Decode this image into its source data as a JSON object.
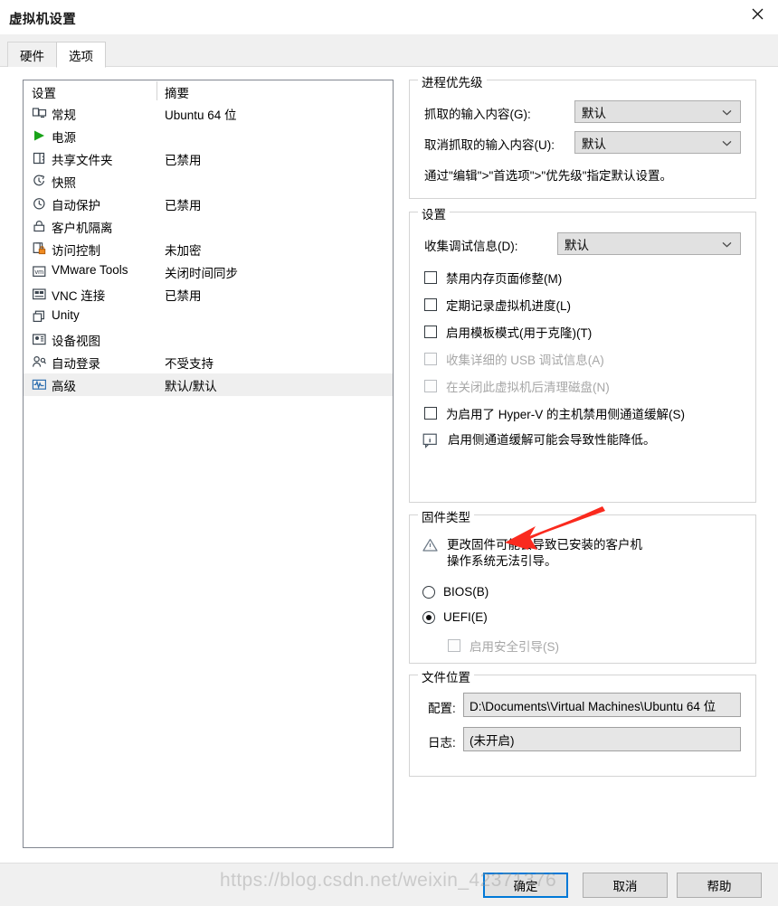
{
  "window": {
    "title": "虚拟机设置",
    "close_icon": "close-icon"
  },
  "tabs": [
    {
      "label": "硬件",
      "active": false
    },
    {
      "label": "选项",
      "active": true
    }
  ],
  "settings_list": {
    "headers": {
      "name": "设置",
      "summary": "摘要"
    },
    "rows": [
      {
        "icon": "monitor-icon",
        "name": "常规",
        "summary": "Ubuntu 64 位",
        "selected": false
      },
      {
        "icon": "power-play-icon",
        "name": "电源",
        "summary": "",
        "selected": false
      },
      {
        "icon": "shared-folder-icon",
        "name": "共享文件夹",
        "summary": "已禁用",
        "selected": false
      },
      {
        "icon": "snapshot-icon",
        "name": "快照",
        "summary": "",
        "selected": false
      },
      {
        "icon": "autoprotect-icon",
        "name": "自动保护",
        "summary": "已禁用",
        "selected": false
      },
      {
        "icon": "lock-icon",
        "name": "客户机隔离",
        "summary": "",
        "selected": false
      },
      {
        "icon": "access-lock-icon",
        "name": "访问控制",
        "summary": "未加密",
        "selected": false
      },
      {
        "icon": "vmware-tools-icon",
        "name": "VMware Tools",
        "summary": "关闭时间同步",
        "selected": false
      },
      {
        "icon": "vnc-icon",
        "name": "VNC 连接",
        "summary": "已禁用",
        "selected": false
      },
      {
        "icon": "unity-icon",
        "name": "Unity",
        "summary": "",
        "selected": false
      },
      {
        "icon": "device-view-icon",
        "name": "设备视图",
        "summary": "",
        "selected": false
      },
      {
        "icon": "autologon-icon",
        "name": "自动登录",
        "summary": "不受支持",
        "selected": false
      },
      {
        "icon": "advanced-icon",
        "name": "高级",
        "summary": "默认/默认",
        "selected": true
      }
    ]
  },
  "process_priority": {
    "legend": "进程优先级",
    "grab_label": "抓取的输入内容(G):",
    "grab_value": "默认",
    "ungrab_label": "取消抓取的输入内容(U):",
    "ungrab_value": "默认",
    "hint": "通过\"编辑\">\"首选项\">\"优先级\"指定默认设置。"
  },
  "settings_group": {
    "legend": "设置",
    "debug_label": "收集调试信息(D):",
    "debug_value": "默认",
    "checkboxes": [
      {
        "label": "禁用内存页面修整(M)",
        "checked": false,
        "disabled": false
      },
      {
        "label": "定期记录虚拟机进度(L)",
        "checked": false,
        "disabled": false
      },
      {
        "label": "启用模板模式(用于克隆)(T)",
        "checked": false,
        "disabled": false
      },
      {
        "label": "收集详细的 USB 调试信息(A)",
        "checked": false,
        "disabled": true
      },
      {
        "label": "在关闭此虚拟机后清理磁盘(N)",
        "checked": false,
        "disabled": true
      },
      {
        "label": "为启用了 Hyper-V 的主机禁用侧通道缓解(S)",
        "checked": false,
        "disabled": false
      }
    ],
    "info_icon": "info-bubble-icon",
    "info_text": "启用侧通道缓解可能会导致性能降低。"
  },
  "firmware": {
    "legend": "固件类型",
    "warning_icon": "warning-triangle-icon",
    "warning_text": "更改固件可能会导致已安装的客户机\n操作系统无法引导。",
    "options": [
      {
        "label": "BIOS(B)",
        "selected": false
      },
      {
        "label": "UEFI(E)",
        "selected": true
      }
    ],
    "secure_boot": {
      "label": "启用安全引导(S)",
      "checked": false,
      "disabled": true
    }
  },
  "file_location": {
    "legend": "文件位置",
    "config_label": "配置:",
    "config_value": "D:\\Documents\\Virtual Machines\\Ubuntu 64 位",
    "log_label": "日志:",
    "log_value": "(未开启)"
  },
  "footer": {
    "ok": "确定",
    "cancel": "取消",
    "help": "帮助"
  },
  "annotation": {
    "arrow_color": "#fa2a1e",
    "watermark": "https://blog.csdn.net/weixin_42371376"
  }
}
